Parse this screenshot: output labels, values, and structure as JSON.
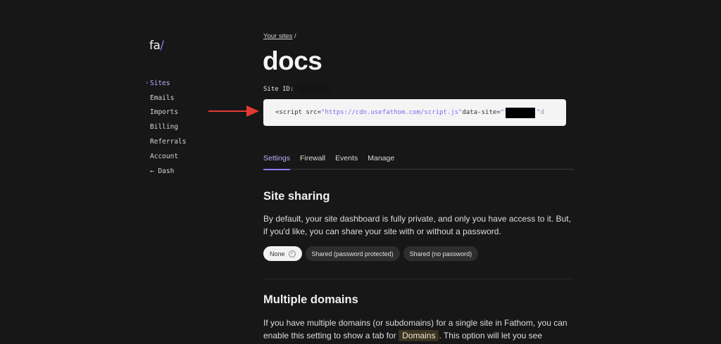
{
  "logo": {
    "main": "fa",
    "slash": "/"
  },
  "nav": {
    "items": [
      {
        "label": "Sites",
        "active": true
      },
      {
        "label": "Emails"
      },
      {
        "label": "Imports"
      },
      {
        "label": "Billing"
      },
      {
        "label": "Referrals"
      },
      {
        "label": "Account"
      },
      {
        "label": "← Dash"
      }
    ]
  },
  "breadcrumb": {
    "link": "Your sites",
    "separator": " /"
  },
  "title": "docs",
  "site_id": {
    "label": "Site ID:"
  },
  "embed": {
    "part1": "<script src=",
    "src": "\"https://cdn.usefathom.com/script.js\"",
    "part2": " data-site=",
    "quote_open": "\"",
    "quote_close": "\"",
    "tail": " d"
  },
  "tabs": [
    "Settings",
    "Firewall",
    "Events",
    "Manage"
  ],
  "sharing": {
    "heading": "Site sharing",
    "text": "By default, your site dashboard is fully private, and only you have access to it. But, if you'd like, you can share your site with or without a password.",
    "options": [
      "None",
      "Shared (password protected)",
      "Shared (no password)"
    ],
    "selected": "None"
  },
  "domains": {
    "heading": "Multiple domains",
    "text_before": "If you have multiple domains (or subdomains) for a single site in Fathom, you can enable this setting to show a tab for ",
    "highlight": "Domains",
    "text_after": ". This option will let you see"
  },
  "colors": {
    "accent": "#8b7cf6",
    "background": "#171717",
    "arrow": "#e53935"
  }
}
